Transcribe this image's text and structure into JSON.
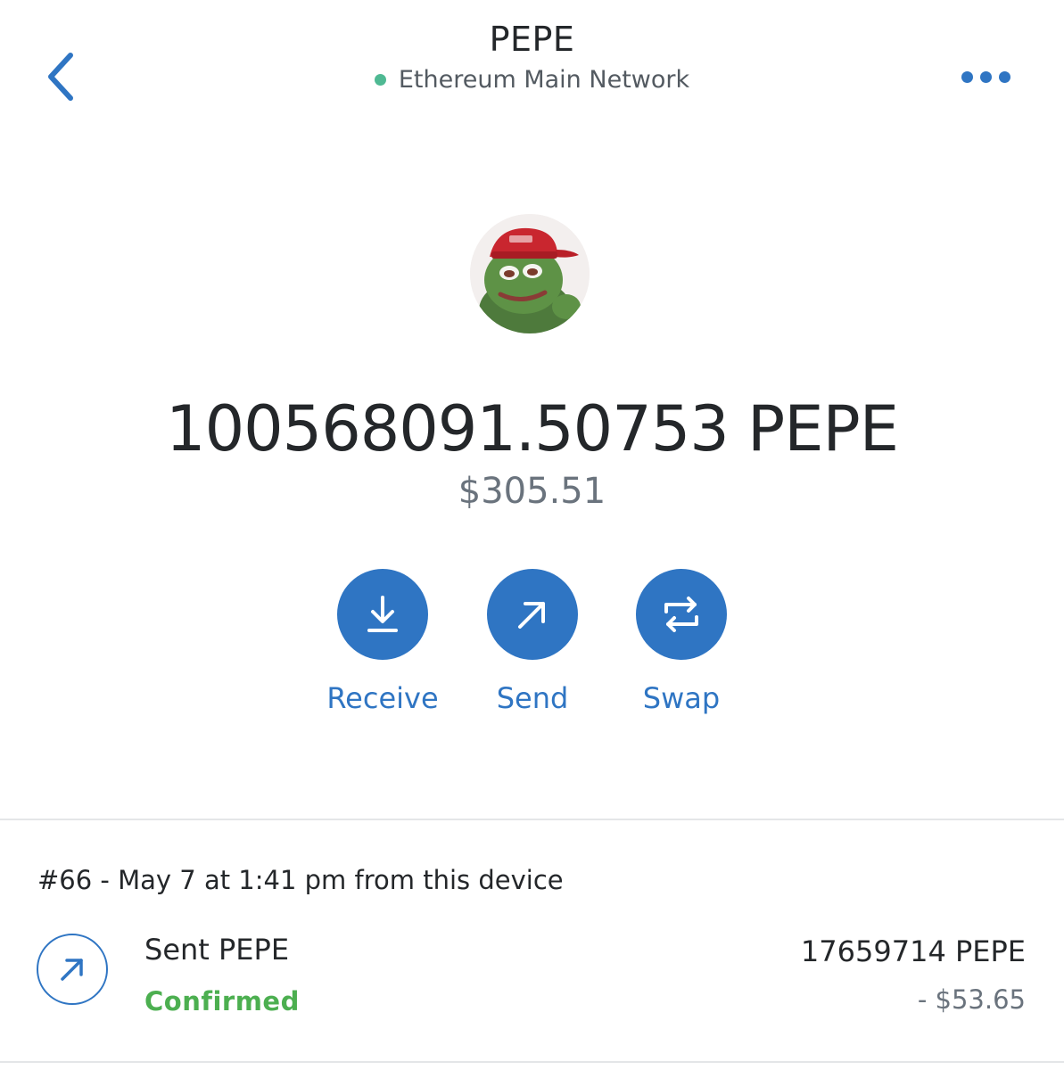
{
  "header": {
    "title": "PEPE",
    "network": "Ethereum Main Network"
  },
  "colors": {
    "accent": "#2f75c3",
    "network_dot": "#4fb993",
    "confirmed": "#4caf50"
  },
  "icons": {
    "back": "chevron-left-icon",
    "more": "more-horizontal-icon",
    "token": "pepe-token-avatar",
    "receive": "download-icon",
    "send": "arrow-up-right-icon",
    "swap": "swap-arrows-icon"
  },
  "token": {
    "balance": "100568091.50753 PEPE",
    "fiat": "$305.51"
  },
  "actions": {
    "receive": "Receive",
    "send": "Send",
    "swap": "Swap"
  },
  "transactions": [
    {
      "header": "#66 - May 7 at 1:41 pm from this device",
      "title": "Sent PEPE",
      "status": "Confirmed",
      "amount": "17659714 PEPE",
      "fiat": "- $53.65"
    }
  ]
}
